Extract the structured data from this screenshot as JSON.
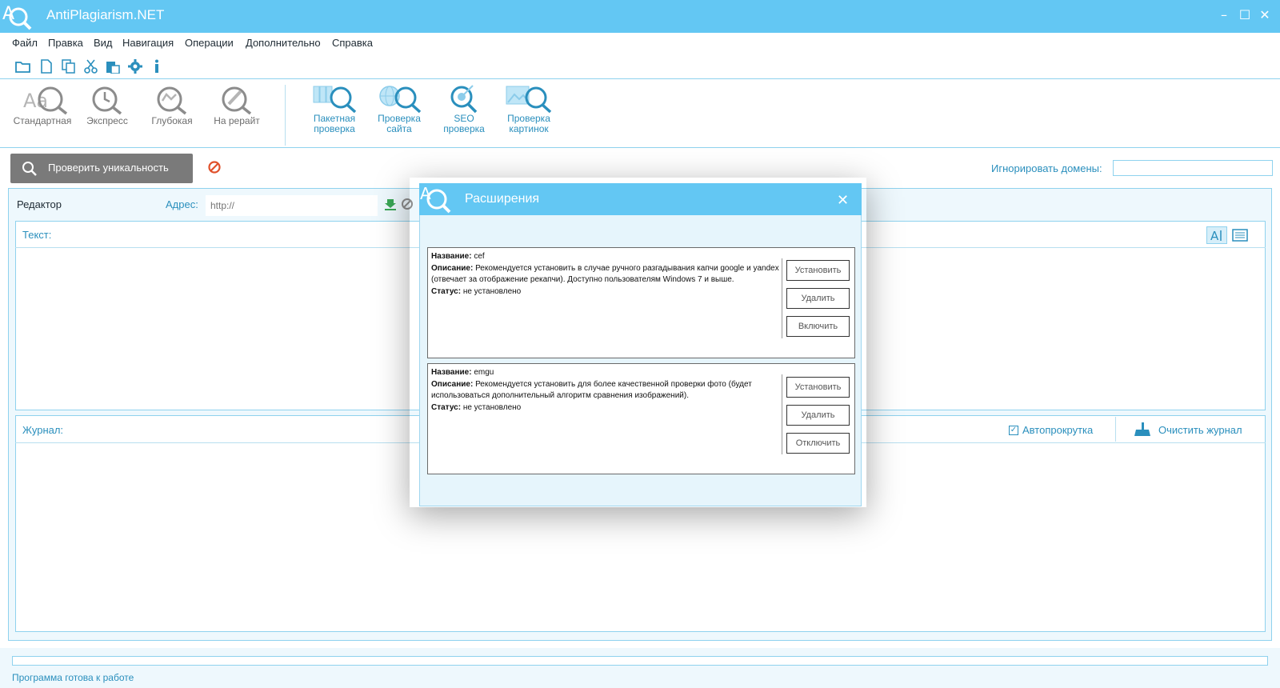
{
  "app": {
    "title": "AntiPlagiarism.NET"
  },
  "menu": [
    "Файл",
    "Правка",
    "Вид",
    "Навигация",
    "Операции",
    "Дополнительно",
    "Справка"
  ],
  "ribbon": {
    "standard": "Стандартная",
    "express": "Экспресс",
    "deep": "Глубокая",
    "rewrite": "На рерайт",
    "batch": [
      "Пакетная",
      "проверка"
    ],
    "site": [
      "Проверка",
      "сайта"
    ],
    "seo": [
      "SEO",
      "проверка"
    ],
    "images": [
      "Проверка",
      "картинок"
    ]
  },
  "check": {
    "button": "Проверить уникальность",
    "ignore_label": "Игнорировать домены:"
  },
  "editor": {
    "label": "Редактор",
    "address_label": "Адрес:",
    "address_placeholder": "http://",
    "text_label": "Текст:"
  },
  "log": {
    "label": "Журнал:",
    "autoscroll": "Автопрокрутка",
    "autoscroll_checked": true,
    "clear": "Очистить журнал"
  },
  "status": {
    "text": "Программа готова к работе"
  },
  "dialog": {
    "title": "Расширения",
    "extensions": [
      {
        "name_label": "Название:",
        "name": "cef",
        "desc_label": "Описание:",
        "desc": "Рекомендуется установить в случае ручного разгадывания капчи google и yandex (отвечает за отображение рекапчи). Доступно пользователям Windows 7 и выше.",
        "status_label": "Статус:",
        "status": "не установлено",
        "buttons": [
          "Установить",
          "Удалить",
          "Включить"
        ]
      },
      {
        "name_label": "Название:",
        "name": "emgu",
        "desc_label": "Описание:",
        "desc": "Рекомендуется установить для более качественной проверки фото (будет использоваться дополнительный алгоритм сравнения изображений).",
        "status_label": "Статус:",
        "status": "не установлено",
        "buttons": [
          "Установить",
          "Удалить",
          "Отключить"
        ]
      }
    ]
  },
  "colors": {
    "accent": "#63c7f3",
    "accent_text": "#2a8fbd",
    "border": "#8fd2ee"
  }
}
